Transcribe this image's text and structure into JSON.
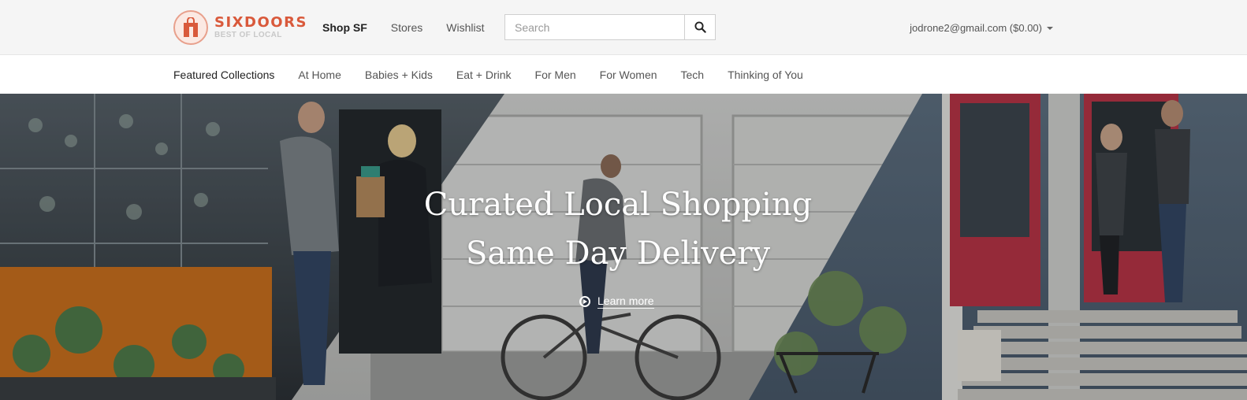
{
  "brand": {
    "name": "SIXDOORS",
    "tagline": "BEST OF LOCAL",
    "accent": "#d9593b"
  },
  "header": {
    "nav": [
      {
        "label": "Shop SF",
        "active": true
      },
      {
        "label": "Stores",
        "active": false
      },
      {
        "label": "Wishlist",
        "active": false
      }
    ],
    "search": {
      "placeholder": "Search",
      "value": "",
      "icon": "search-icon"
    },
    "account": {
      "label": "jodrone2@gmail.com ($0.00)",
      "icon": "caret-down-icon"
    }
  },
  "categories": [
    "Featured Collections",
    "At Home",
    "Babies + Kids",
    "Eat + Drink",
    "For Men",
    "For Women",
    "Tech",
    "Thinking of You"
  ],
  "hero": {
    "headline_1": "Curated Local Shopping",
    "headline_2": "Same Day Delivery",
    "cta_label": "Learn more",
    "cta_icon": "play-circle-icon"
  }
}
